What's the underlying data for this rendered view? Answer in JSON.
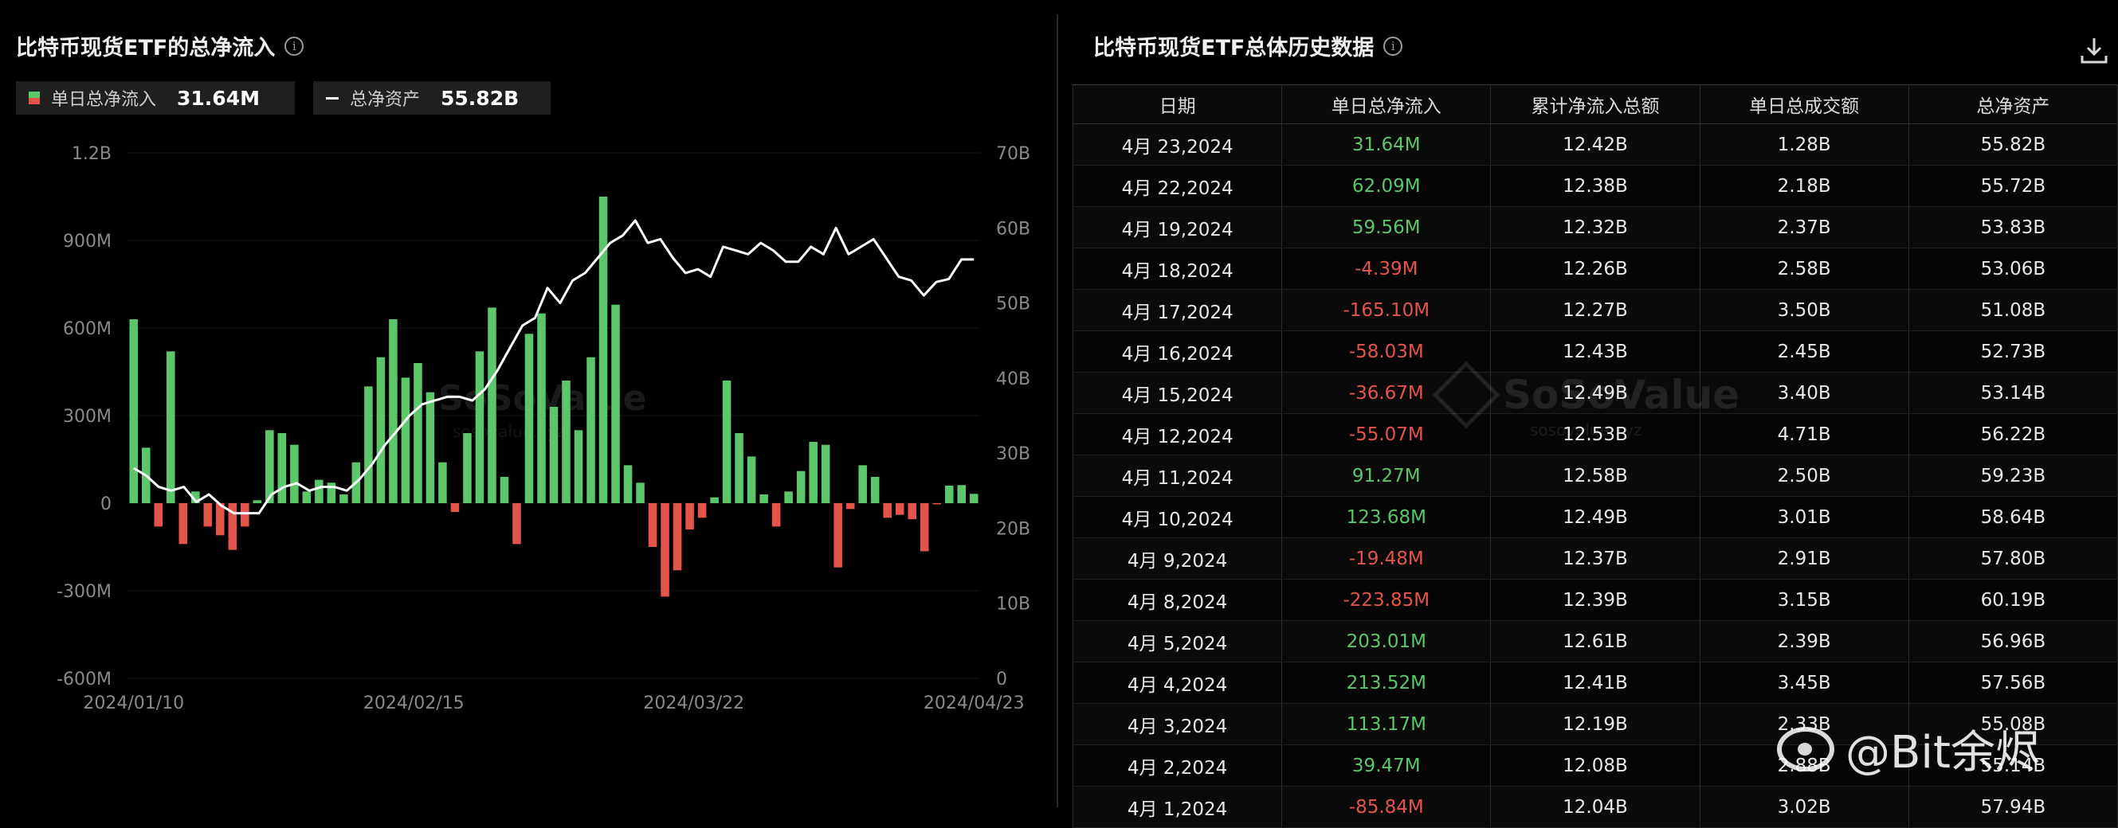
{
  "left": {
    "title": "比特币现货ETF的总净流入",
    "legend": [
      {
        "label": "单日总净流入",
        "value": "31.64M"
      },
      {
        "label": "总净资产",
        "value": "55.82B"
      }
    ],
    "watermark": "SoSoValue",
    "watermark_sub": "sosovalue.xyz"
  },
  "right": {
    "title": "比特币现货ETF总体历史数据",
    "columns": [
      "日期",
      "单日总净流入",
      "累计净流入总额",
      "单日总成交额",
      "总净资产"
    ],
    "rows": [
      [
        "4月 23,2024",
        "31.64M",
        "12.42B",
        "1.28B",
        "55.82B"
      ],
      [
        "4月 22,2024",
        "62.09M",
        "12.38B",
        "2.18B",
        "55.72B"
      ],
      [
        "4月 19,2024",
        "59.56M",
        "12.32B",
        "2.37B",
        "53.83B"
      ],
      [
        "4月 18,2024",
        "-4.39M",
        "12.26B",
        "2.58B",
        "53.06B"
      ],
      [
        "4月 17,2024",
        "-165.10M",
        "12.27B",
        "3.50B",
        "51.08B"
      ],
      [
        "4月 16,2024",
        "-58.03M",
        "12.43B",
        "2.45B",
        "52.73B"
      ],
      [
        "4月 15,2024",
        "-36.67M",
        "12.49B",
        "3.40B",
        "53.14B"
      ],
      [
        "4月 12,2024",
        "-55.07M",
        "12.53B",
        "4.71B",
        "56.22B"
      ],
      [
        "4月 11,2024",
        "91.27M",
        "12.58B",
        "2.50B",
        "59.23B"
      ],
      [
        "4月 10,2024",
        "123.68M",
        "12.49B",
        "3.01B",
        "58.64B"
      ],
      [
        "4月 9,2024",
        "-19.48M",
        "12.37B",
        "2.91B",
        "57.80B"
      ],
      [
        "4月 8,2024",
        "-223.85M",
        "12.39B",
        "3.15B",
        "60.19B"
      ],
      [
        "4月 5,2024",
        "203.01M",
        "12.61B",
        "2.39B",
        "56.96B"
      ],
      [
        "4月 4,2024",
        "213.52M",
        "12.41B",
        "3.45B",
        "57.56B"
      ],
      [
        "4月 3,2024",
        "113.17M",
        "12.19B",
        "2.33B",
        "55.08B"
      ],
      [
        "4月 2,2024",
        "39.47M",
        "12.08B",
        "2.88B",
        "55.14B"
      ],
      [
        "4月 1,2024",
        "-85.84M",
        "12.04B",
        "3.02B",
        "57.94B"
      ]
    ],
    "watermark": "SoSoValue",
    "watermark_sub": "sosovalue.xyz"
  },
  "weibo_watermark": "@Bit余烬",
  "colors": {
    "positive": "#5cc66a",
    "negative": "#e5544a",
    "line": "#ffffff",
    "background": "#000000"
  },
  "chart_data": {
    "type": "bar",
    "title": "比特币现货ETF的总净流入",
    "x_ticks": [
      "2024/01/10",
      "2024/02/15",
      "2024/03/22",
      "2024/04/23"
    ],
    "y_left_ticks": [
      "1.2B",
      "900M",
      "600M",
      "300M",
      "0",
      "-300M",
      "-600M"
    ],
    "y_left_range": [
      -600,
      1200
    ],
    "y_right_ticks": [
      "70B",
      "60B",
      "50B",
      "40B",
      "30B",
      "20B",
      "10B",
      "0"
    ],
    "y_right_range": [
      0,
      70
    ],
    "series": [
      {
        "name": "单日总净流入",
        "type": "bar",
        "unit": "M",
        "values": [
          630,
          190,
          -80,
          520,
          -140,
          40,
          -80,
          -110,
          -160,
          -80,
          10,
          250,
          240,
          200,
          40,
          80,
          70,
          30,
          140,
          400,
          500,
          630,
          430,
          480,
          380,
          140,
          -30,
          240,
          520,
          670,
          90,
          -140,
          580,
          650,
          330,
          420,
          250,
          500,
          1050,
          680,
          130,
          70,
          -150,
          -320,
          -230,
          -90,
          -50,
          20,
          420,
          240,
          160,
          30,
          -80,
          40,
          110,
          210,
          200,
          -220,
          -20,
          130,
          90,
          -50,
          -40,
          -55,
          -165,
          -4,
          60,
          62,
          32
        ]
      },
      {
        "name": "总净资产",
        "type": "line",
        "unit": "B",
        "values": [
          28,
          27,
          25.5,
          25,
          25.5,
          23.5,
          24.5,
          23,
          22,
          22,
          22,
          24.5,
          25.5,
          26,
          25,
          25.5,
          25.5,
          25,
          26.5,
          28.5,
          31,
          33,
          35,
          36.5,
          37,
          37.5,
          37.5,
          37,
          38.5,
          41,
          44,
          47,
          48,
          52,
          50,
          53,
          54,
          56,
          58,
          59,
          61,
          58,
          58.5,
          56,
          54,
          54.5,
          53.5,
          57.5,
          57,
          56.5,
          58,
          57,
          55.5,
          55.5,
          57.5,
          56.5,
          60,
          56.5,
          57.5,
          58.5,
          56,
          53.5,
          53,
          51,
          52.8,
          53.2,
          55.8,
          55.8
        ]
      }
    ]
  }
}
